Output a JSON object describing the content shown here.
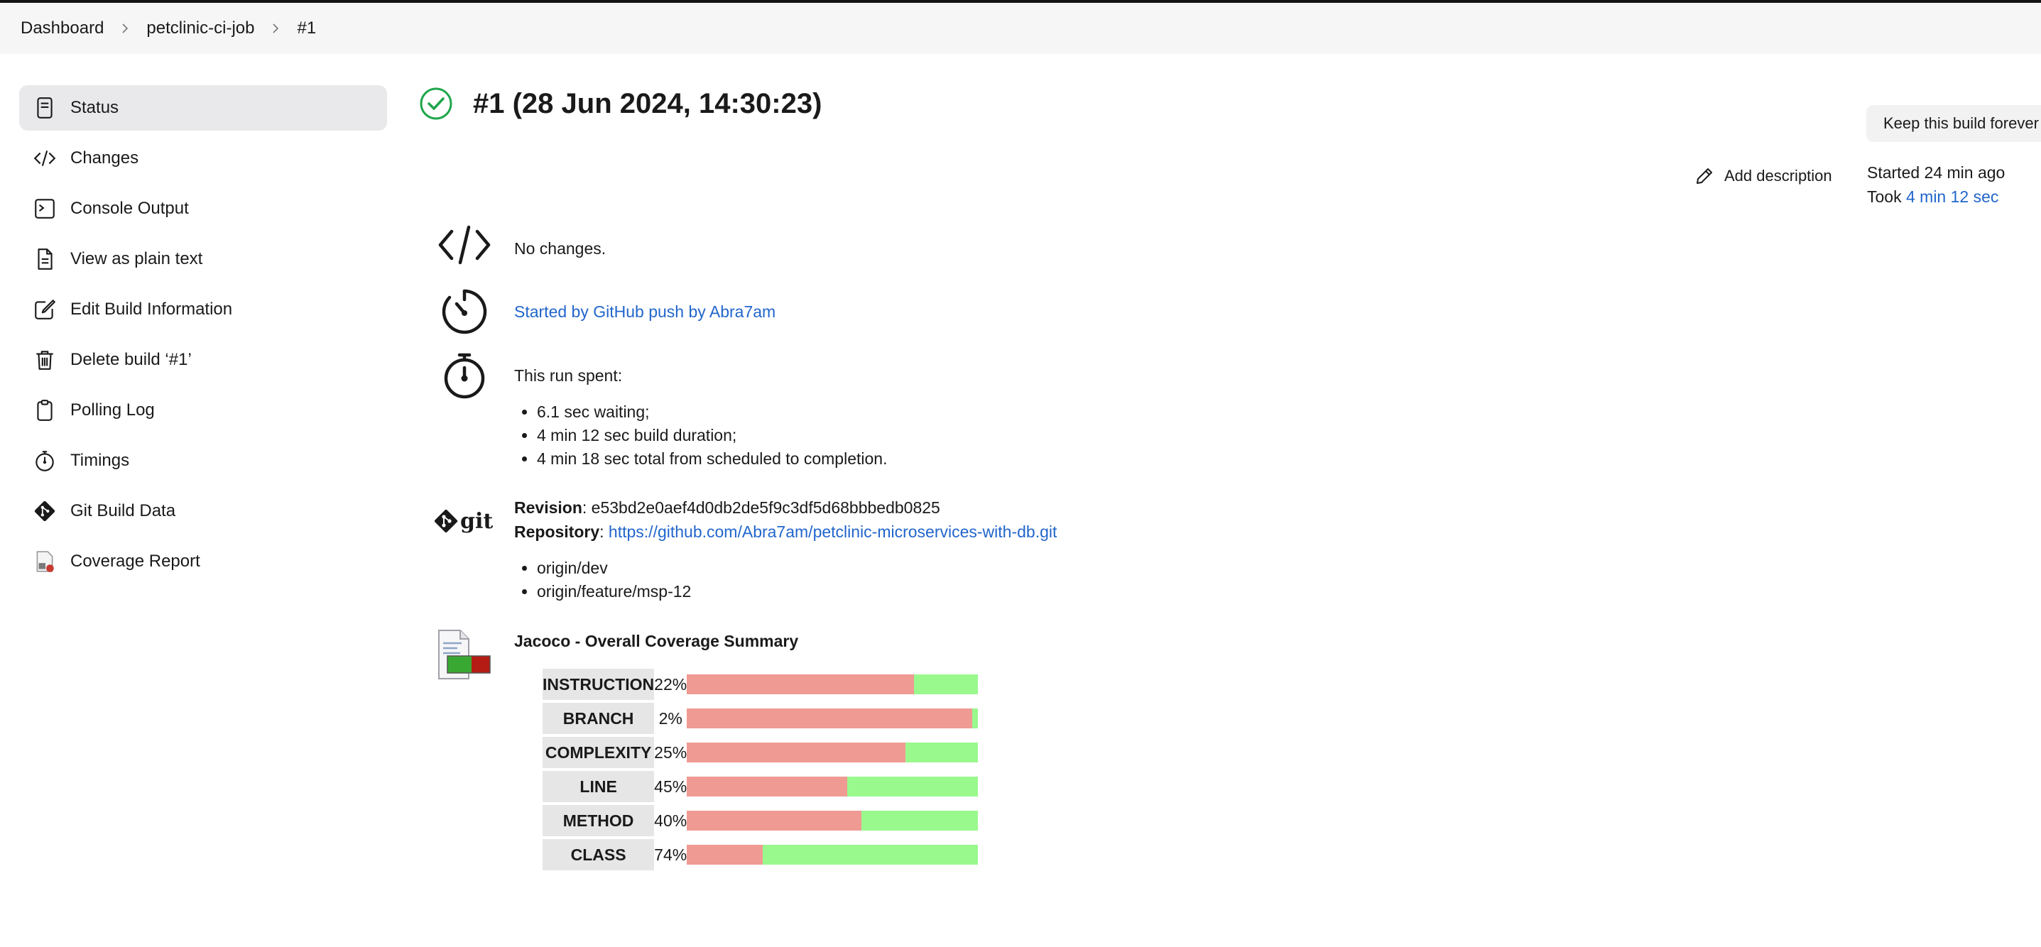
{
  "breadcrumb": [
    {
      "label": "Dashboard"
    },
    {
      "label": "petclinic-ci-job"
    },
    {
      "label": "#1"
    }
  ],
  "sidebar": {
    "items": [
      {
        "label": "Status",
        "icon": "status-icon"
      },
      {
        "label": "Changes",
        "icon": "code-icon"
      },
      {
        "label": "Console Output",
        "icon": "terminal-icon"
      },
      {
        "label": "View as plain text",
        "icon": "document-icon"
      },
      {
        "label": "Edit Build Information",
        "icon": "edit-icon"
      },
      {
        "label": "Delete build ‘#1’",
        "icon": "trash-icon"
      },
      {
        "label": "Polling Log",
        "icon": "clipboard-icon"
      },
      {
        "label": "Timings",
        "icon": "stopwatch-icon"
      },
      {
        "label": "Git Build Data",
        "icon": "git-icon"
      },
      {
        "label": "Coverage Report",
        "icon": "coverage-report-icon"
      }
    ]
  },
  "build": {
    "title": "#1 (28 Jun 2024, 14:30:23)",
    "status": "success",
    "keep_label": "Keep this build forever",
    "add_description": "Add description",
    "started": "Started 24 min ago",
    "took_prefix": "Took ",
    "took_value": "4 min 12 sec"
  },
  "changes": {
    "text": "No changes."
  },
  "cause": {
    "text": "Started by GitHub push by Abra7am"
  },
  "timing": {
    "heading": "This run spent:",
    "items": [
      "6.1 sec waiting;",
      "4 min 12 sec build duration;",
      "4 min 18 sec total from scheduled to completion."
    ]
  },
  "git": {
    "logo_text": "git",
    "revision_label": "Revision",
    "revision": "e53bd2e0aef4d0db2de5f9c3df5d68bbbedb0825",
    "repository_label": "Repository",
    "repository": "https://github.com/Abra7am/petclinic-microservices-with-db.git",
    "branches": [
      "origin/dev",
      "origin/feature/msp-12"
    ]
  },
  "coverage": {
    "title": "Jacoco - Overall Coverage Summary",
    "colors": {
      "covered": "#99f98d",
      "missed": "#f09a94"
    },
    "rows": [
      {
        "name": "INSTRUCTION",
        "pct_label": "22%",
        "covered": 0.22
      },
      {
        "name": "BRANCH",
        "pct_label": "2%",
        "covered": 0.02
      },
      {
        "name": "COMPLEXITY",
        "pct_label": "25%",
        "covered": 0.25
      },
      {
        "name": "LINE",
        "pct_label": "45%",
        "covered": 0.45
      },
      {
        "name": "METHOD",
        "pct_label": "40%",
        "covered": 0.4
      },
      {
        "name": "CLASS",
        "pct_label": "74%",
        "covered": 0.74
      }
    ]
  }
}
